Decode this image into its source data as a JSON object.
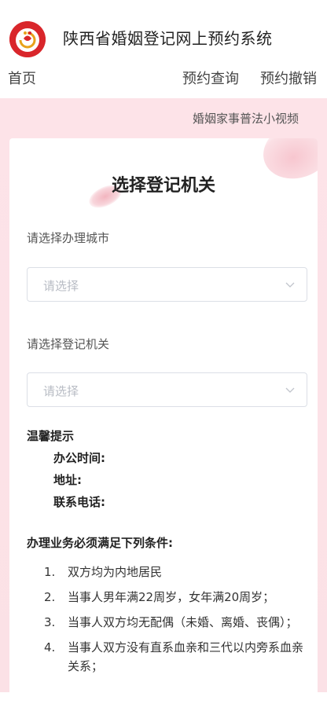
{
  "header": {
    "logo_icon": "marriage-registration-logo",
    "title": "陕西省婚姻登记网上预约系统",
    "nav": {
      "home": "首页",
      "query": "预约查询",
      "cancel": "预约撤销"
    }
  },
  "promo_link": "婚姻家事普法小视频",
  "card": {
    "title": "选择登记机关",
    "city_label": "请选择办理城市",
    "city_placeholder": "请选择",
    "office_label": "请选择登记机关",
    "office_placeholder": "请选择",
    "tips": {
      "title": "温馨提示",
      "office_hours": "办公时间:",
      "address": "地址:",
      "phone": "联系电话:"
    },
    "conditions_title": "办理业务必须满足下列条件:",
    "conditions": [
      {
        "num": "1.",
        "text": "双方均为内地居民"
      },
      {
        "num": "2.",
        "text": "当事人男年满22周岁，女年满20周岁；"
      },
      {
        "num": "3.",
        "text": "当事人双方均无配偶（未婚、离婚、丧偶）；"
      },
      {
        "num": "4.",
        "text": "当事人双方没有直系血亲和三代以内旁系血亲关系；"
      }
    ]
  },
  "colors": {
    "accent": "#d9262b",
    "background_pink": "#fde3e8"
  }
}
